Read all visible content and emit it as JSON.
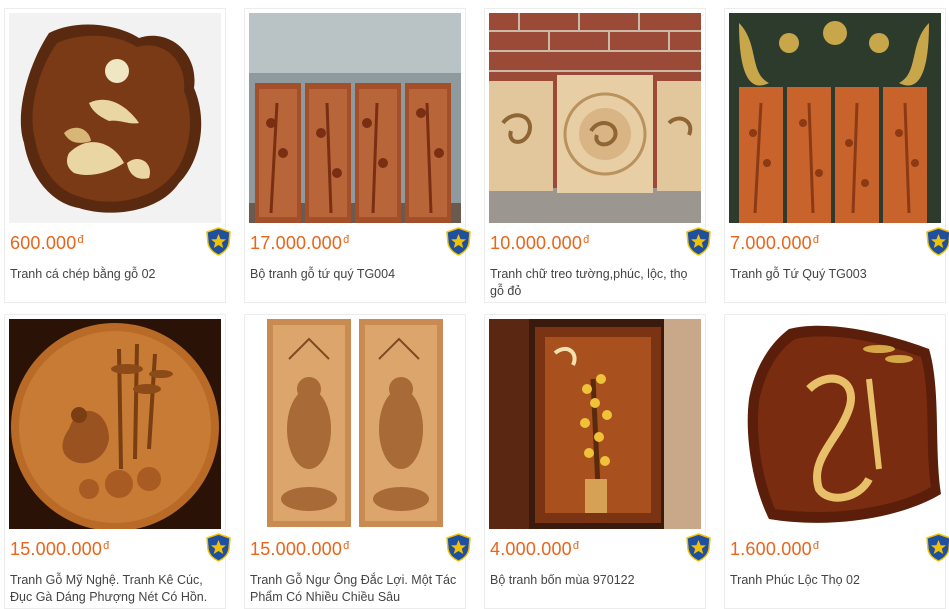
{
  "products": [
    {
      "price": "600.000",
      "currency": "đ",
      "title": "Tranh cá chép bằng gỗ 02"
    },
    {
      "price": "17.000.000",
      "currency": "đ",
      "title": "Bộ tranh gỗ tứ quý TG004"
    },
    {
      "price": "10.000.000",
      "currency": "đ",
      "title": "Tranh chữ treo tường,phúc, lộc, thọ gỗ đỏ"
    },
    {
      "price": "7.000.000",
      "currency": "đ",
      "title": "Tranh gỗ Tứ Quý TG003"
    },
    {
      "price": "15.000.000",
      "currency": "đ",
      "title": "Tranh Gỗ Mỹ Nghệ. Tranh Kê Cúc, Đục Gà Dáng Phượng Nét Có Hồn."
    },
    {
      "price": "15.000.000",
      "currency": "đ",
      "title": "Tranh Gỗ Ngư Ông Đắc Lợi. Một Tác Phẩm Có Nhiều Chiều Sâu"
    },
    {
      "price": "4.000.000",
      "currency": "đ",
      "title": "Bộ tranh bốn mùa 970122"
    },
    {
      "price": "1.600.000",
      "currency": "đ",
      "title": "Tranh Phúc Lộc Thọ 02"
    }
  ],
  "colors": {
    "price": "#e8651a",
    "badge_blue": "#1e4fa0",
    "badge_star": "#f2c200",
    "title": "#444444"
  },
  "icons": {
    "badge": "star-shield-icon"
  }
}
